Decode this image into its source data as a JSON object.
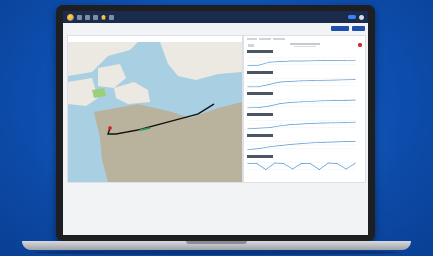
{
  "background": {
    "color": "#0d4fb0",
    "accent": "#1f6fd1"
  },
  "app": {
    "topbar_color": "#1b2b4b",
    "brand_color": "#f6a623",
    "icons": [
      "logo-icon",
      "grid-icon",
      "settings-icon",
      "bell-icon",
      "home-icon",
      "info-icon",
      "toggle-icon",
      "avatar-icon"
    ]
  },
  "map": {
    "water_color": "#a9cfe3",
    "land_color": "#ece9e2",
    "region_color": "#b9b39e",
    "green_color": "#9ccf7a",
    "track_color": "#111111",
    "marker_color": "#d92020"
  },
  "charts": {
    "line_color": "#5b9bd5",
    "stop_color": "#e11d2a",
    "count": 6
  },
  "chart_data": [
    {
      "type": "line",
      "series": [
        {
          "values": [
            0.1,
            0.15,
            0.4,
            0.45,
            0.5,
            0.5,
            0.52,
            0.55,
            0.55,
            0.56,
            0.56
          ]
        }
      ],
      "ylim": [
        0,
        1
      ]
    },
    {
      "type": "line",
      "series": [
        {
          "values": [
            0.1,
            0.1,
            0.3,
            0.5,
            0.55,
            0.6,
            0.62,
            0.64,
            0.66,
            0.68,
            0.7
          ]
        }
      ],
      "ylim": [
        0,
        1
      ]
    },
    {
      "type": "line",
      "series": [
        {
          "values": [
            0.1,
            0.12,
            0.25,
            0.45,
            0.55,
            0.6,
            0.64,
            0.68,
            0.7,
            0.72,
            0.74
          ]
        }
      ],
      "ylim": [
        0,
        1
      ]
    },
    {
      "type": "line",
      "series": [
        {
          "values": [
            0.1,
            0.15,
            0.2,
            0.35,
            0.45,
            0.5,
            0.55,
            0.58,
            0.6,
            0.62,
            0.65
          ]
        }
      ],
      "ylim": [
        0,
        1
      ]
    },
    {
      "type": "line",
      "series": [
        {
          "values": [
            0.1,
            0.2,
            0.35,
            0.45,
            0.55,
            0.62,
            0.68,
            0.72,
            0.75,
            0.78,
            0.8
          ]
        }
      ],
      "ylim": [
        0,
        1
      ]
    },
    {
      "type": "line",
      "series": [
        {
          "values": [
            0.7,
            0.7,
            0.2,
            0.75,
            0.7,
            0.25,
            0.72,
            0.7,
            0.2,
            0.75,
            0.7,
            0.25,
            0.72
          ]
        }
      ],
      "ylim": [
        0,
        1
      ]
    }
  ]
}
